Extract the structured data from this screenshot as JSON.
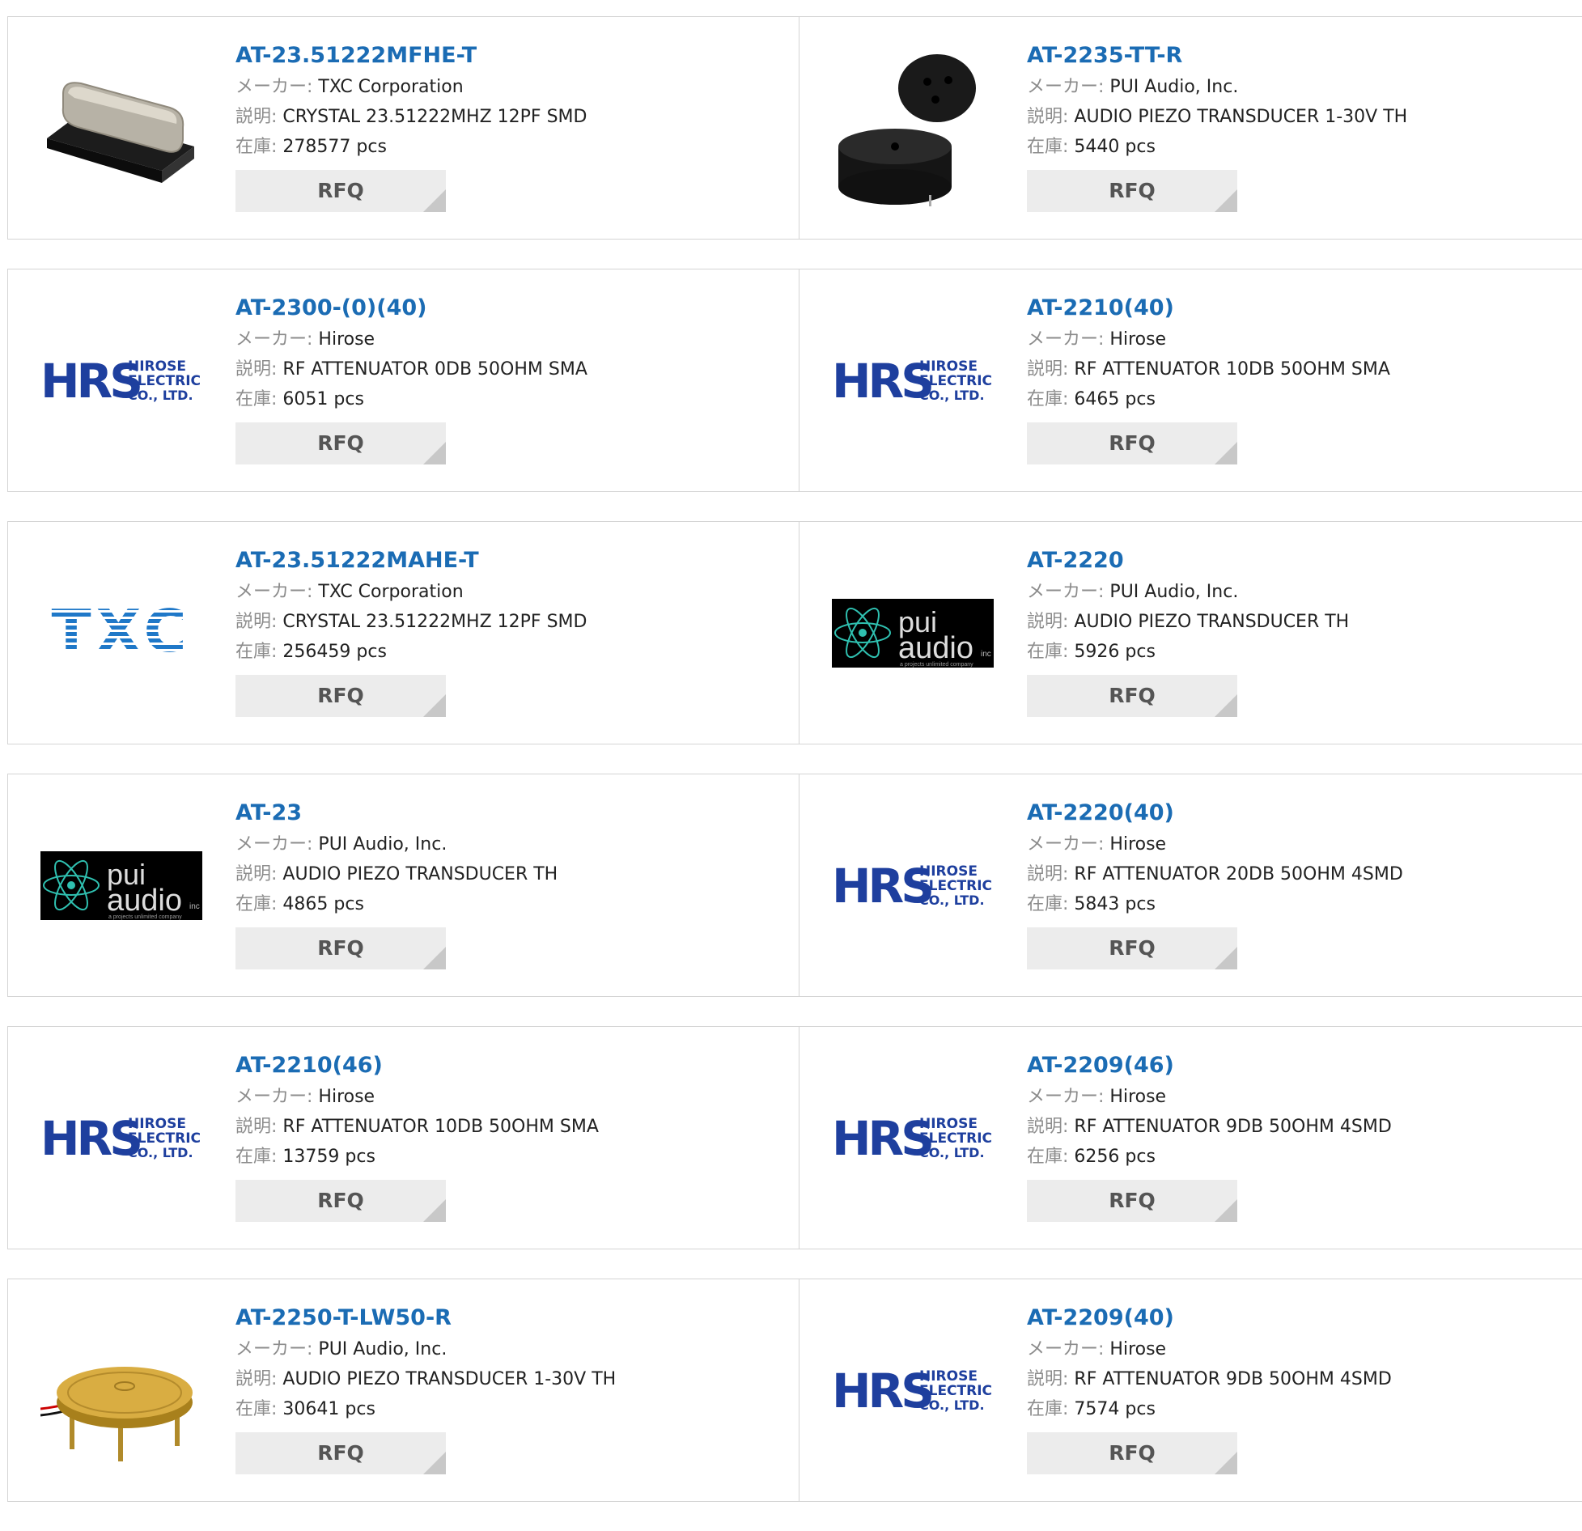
{
  "labels": {
    "maker": "メーカー:",
    "desc": "説明:",
    "stock": "在庫:",
    "rfq": "RFQ"
  },
  "products": [
    {
      "part": "AT-23.51222MFHE-T",
      "maker": "TXC Corporation",
      "desc": "CRYSTAL 23.51222MHZ 12PF SMD",
      "stock": "278577 pcs",
      "image": "crystal-oscillator-photo"
    },
    {
      "part": "AT-2235-TT-R",
      "maker": "PUI Audio, Inc.",
      "desc": "AUDIO PIEZO TRANSDUCER 1-30V TH",
      "stock": "5440 pcs",
      "image": "piezo-buzzer-photo"
    },
    {
      "part": "AT-2300-(0)(40)",
      "maker": "Hirose",
      "desc": "RF ATTENUATOR 0DB 50OHM SMA",
      "stock": "6051 pcs",
      "image": "hrs-logo"
    },
    {
      "part": "AT-2210(40)",
      "maker": "Hirose",
      "desc": "RF ATTENUATOR 10DB 50OHM SMA",
      "stock": "6465 pcs",
      "image": "hrs-logo"
    },
    {
      "part": "AT-23.51222MAHE-T",
      "maker": "TXC Corporation",
      "desc": "CRYSTAL 23.51222MHZ 12PF SMD",
      "stock": "256459 pcs",
      "image": "txc-logo"
    },
    {
      "part": "AT-2220",
      "maker": "PUI Audio, Inc.",
      "desc": "AUDIO PIEZO TRANSDUCER TH",
      "stock": "5926 pcs",
      "image": "pui-audio-logo"
    },
    {
      "part": "AT-23",
      "maker": "PUI Audio, Inc.",
      "desc": "AUDIO PIEZO TRANSDUCER TH",
      "stock": "4865 pcs",
      "image": "pui-audio-logo"
    },
    {
      "part": "AT-2220(40)",
      "maker": "Hirose",
      "desc": "RF ATTENUATOR 20DB 50OHM 4SMD",
      "stock": "5843 pcs",
      "image": "hrs-logo"
    },
    {
      "part": "AT-2210(46)",
      "maker": "Hirose",
      "desc": "RF ATTENUATOR 10DB 50OHM SMA",
      "stock": "13759 pcs",
      "image": "hrs-logo"
    },
    {
      "part": "AT-2209(46)",
      "maker": "Hirose",
      "desc": "RF ATTENUATOR 9DB 50OHM 4SMD",
      "stock": "6256 pcs",
      "image": "hrs-logo"
    },
    {
      "part": "AT-2250-T-LW50-R",
      "maker": "PUI Audio, Inc.",
      "desc": "AUDIO PIEZO TRANSDUCER 1-30V TH",
      "stock": "30641 pcs",
      "image": "piezo-disc-photo"
    },
    {
      "part": "AT-2209(40)",
      "maker": "Hirose",
      "desc": "RF ATTENUATOR 9DB 50OHM 4SMD",
      "stock": "7574 pcs",
      "image": "hrs-logo"
    }
  ],
  "logo_text": {
    "hrs_mark": "HRS",
    "hrs_line1": "HIROSE",
    "hrs_line2": "ELECTRIC",
    "hrs_line3": "CO., LTD.",
    "txc": "TXC",
    "pui_line1": "pui",
    "pui_line2": "audio",
    "pui_inc": "inc",
    "pui_tag": "a projects unlimited company"
  },
  "colors": {
    "link": "#1b6cb4",
    "hrs_blue": "#1e3f9e",
    "txc_blue": "#1f78c8"
  }
}
